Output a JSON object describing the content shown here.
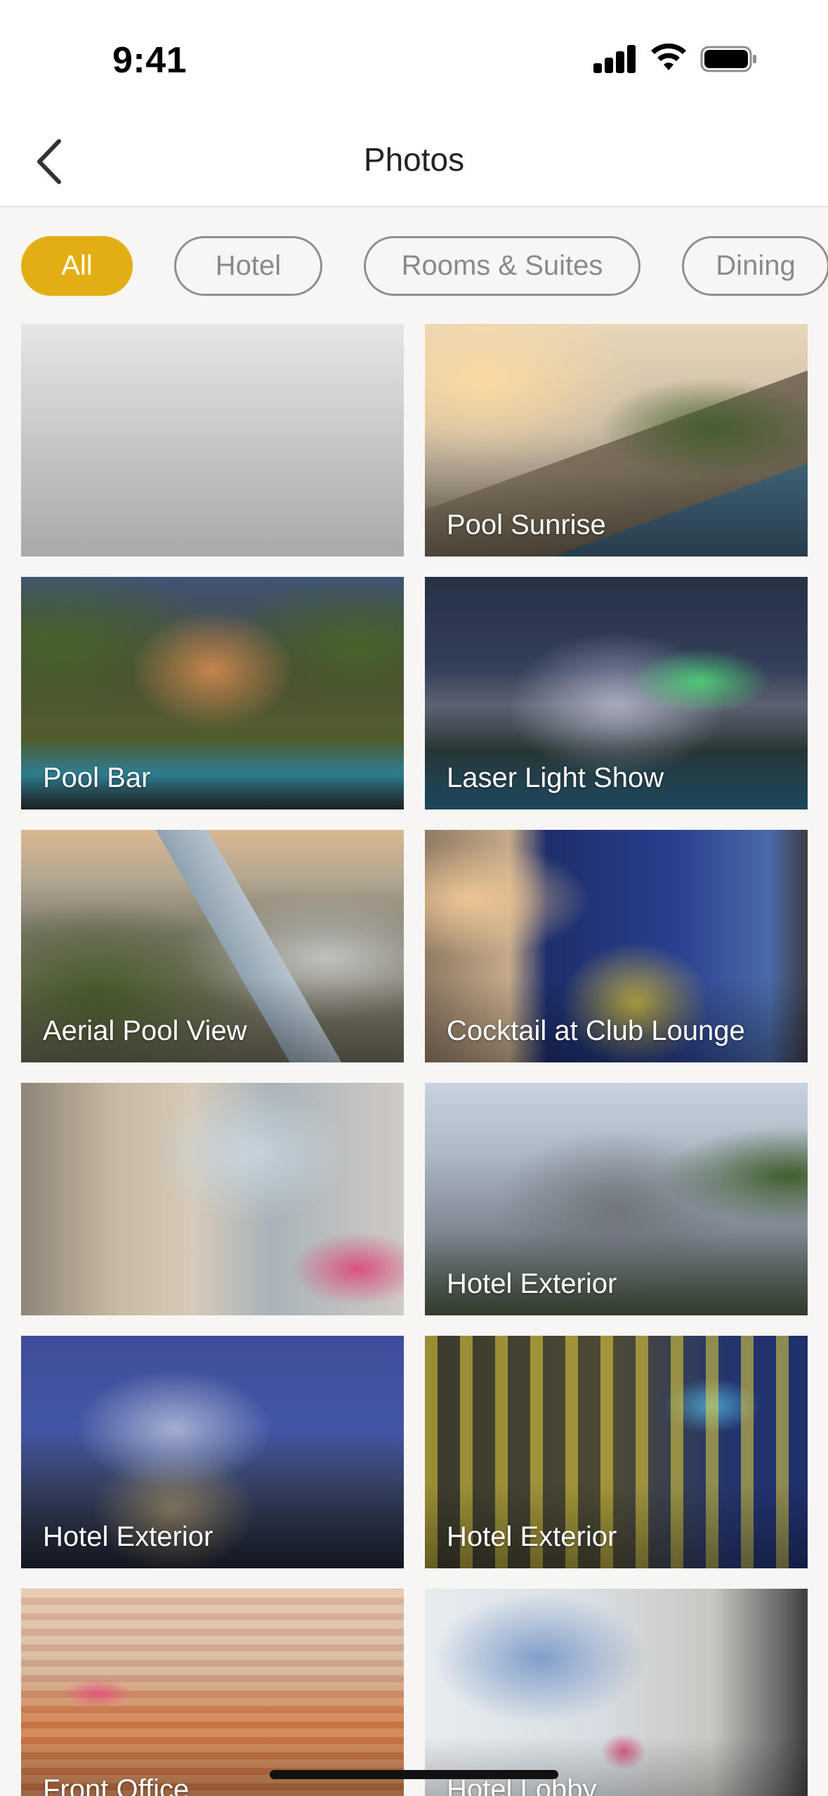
{
  "status_bar": {
    "time": "9:41",
    "icons": [
      "cellular-signal-icon",
      "wifi-icon",
      "battery-icon"
    ]
  },
  "nav": {
    "back_icon": "chevron-left-icon",
    "title": "Photos"
  },
  "filters": [
    {
      "label": "All",
      "active": true
    },
    {
      "label": "Hotel",
      "active": false
    },
    {
      "label": "Rooms & Suites",
      "active": false
    },
    {
      "label": "Dining",
      "active": false
    }
  ],
  "colors": {
    "accent": "#e2ae14",
    "chip_border": "#8f8f8f",
    "background": "#f7f6f4"
  },
  "photos": [
    {
      "caption": ""
    },
    {
      "caption": "Pool Sunrise"
    },
    {
      "caption": "Pool Bar"
    },
    {
      "caption": "Laser Light Show"
    },
    {
      "caption": "Aerial Pool View"
    },
    {
      "caption": "Cocktail at Club Lounge"
    },
    {
      "caption": ""
    },
    {
      "caption": "Hotel Exterior"
    },
    {
      "caption": "Hotel Exterior"
    },
    {
      "caption": "Hotel Exterior"
    },
    {
      "caption": "Front Office"
    },
    {
      "caption": "Hotel Lobby"
    }
  ]
}
